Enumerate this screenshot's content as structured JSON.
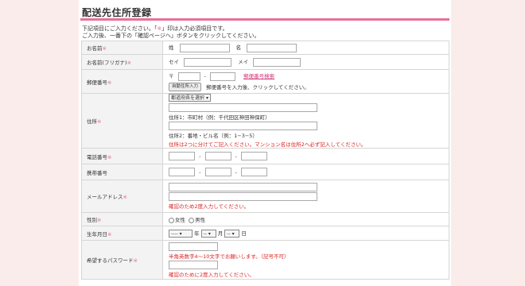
{
  "page_title": "配送先住所登録",
  "intro": {
    "line1_a": "下記項目にご入力ください。「",
    "line1_req": "※",
    "line1_b": "」印は入力必須項目です。",
    "line2": "ご入力後、一番下の「確認ページへ」ボタンをクリックしてください。"
  },
  "required_mark": "※",
  "rows": {
    "name": {
      "label": "お名前",
      "sei_label": "姓",
      "mei_label": "名"
    },
    "kana": {
      "label": "お名前(フリガナ)",
      "sei_label": "セイ",
      "mei_label": "メイ"
    },
    "zip": {
      "label": "郵便番号",
      "prefix": "〒",
      "dash": "-",
      "search_link": "郵便番号検索",
      "auto_button": "自動住所入力",
      "hint": "郵便番号を入力後、クリックしてください。"
    },
    "address": {
      "label": "住所",
      "prefecture_select": "都道府県を選択",
      "caption1": "住所1：市町村（例：千代田区神田神保町）",
      "caption2": "住所2：番地・ビル名（例：1−3−5）",
      "warning": "住所は2つに分けてご記入ください。マンション名は住所2へ必ず記入してください。"
    },
    "phone": {
      "label": "電話番号",
      "dash": "-"
    },
    "mobile": {
      "label": "携帯番号",
      "dash": "-"
    },
    "email": {
      "label": "メールアドレス",
      "confirm_note": "確認のため2度入力してください。"
    },
    "gender": {
      "label": "性別",
      "option_female": "女性",
      "option_male": "男性"
    },
    "birthday": {
      "label": "生年月日",
      "year_value": "----",
      "year_unit": "年",
      "month_value": "--",
      "month_unit": "月",
      "day_value": "--",
      "day_unit": "日"
    },
    "password": {
      "label": "希望するパスワード",
      "rule_note": "半角英数字4〜10文字でお願いします。（記号不可）",
      "confirm_note": "確認のために2度入力してください。"
    }
  },
  "colors": {
    "accent": "#e8709a",
    "background": "#fbecec",
    "warning": "#dd2222",
    "label_bg": "#f3f3f3"
  }
}
